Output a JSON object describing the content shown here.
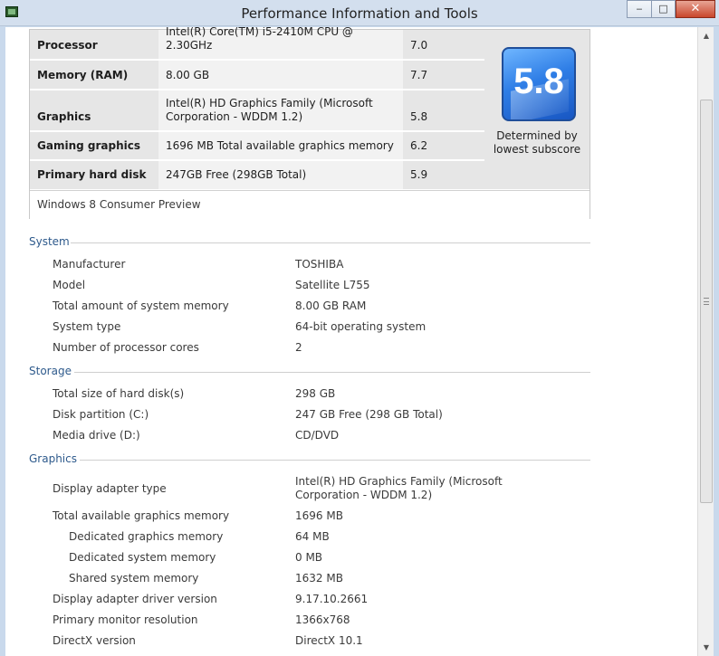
{
  "window": {
    "title": "Performance Information and Tools",
    "min_label": "▭",
    "max_label": "▢",
    "close_label": "✕"
  },
  "scores": {
    "rows": [
      {
        "component": "Processor",
        "rating": "Intel(R) Core(TM) i5-2410M CPU @ 2.30GHz",
        "subscore": "7.0"
      },
      {
        "component": "Memory (RAM)",
        "rating": "8.00 GB",
        "subscore": "7.7"
      },
      {
        "component": "Graphics",
        "rating": "Intel(R) HD Graphics Family (Microsoft Corporation - WDDM 1.2)",
        "subscore": "5.8"
      },
      {
        "component": "Gaming graphics",
        "rating": "1696 MB Total available graphics memory",
        "subscore": "6.2"
      },
      {
        "component": "Primary hard disk",
        "rating": "247GB Free (298GB Total)",
        "subscore": "5.9"
      }
    ],
    "base_score": "5.8",
    "base_caption": "Determined by lowest subscore",
    "edition": "Windows 8 Consumer Preview"
  },
  "system": {
    "heading": "System",
    "items": [
      {
        "label": "Manufacturer",
        "value": "TOSHIBA"
      },
      {
        "label": "Model",
        "value": "Satellite L755"
      },
      {
        "label": "Total amount of system memory",
        "value": "8.00 GB RAM"
      },
      {
        "label": "System type",
        "value": "64-bit operating system"
      },
      {
        "label": "Number of processor cores",
        "value": "2"
      }
    ]
  },
  "storage": {
    "heading": "Storage",
    "items": [
      {
        "label": "Total size of hard disk(s)",
        "value": "298 GB"
      },
      {
        "label": "Disk partition (C:)",
        "value": "247 GB Free (298 GB Total)"
      },
      {
        "label": "Media drive (D:)",
        "value": "CD/DVD"
      }
    ]
  },
  "graphics": {
    "heading": "Graphics",
    "items": [
      {
        "label": "Display adapter type",
        "value": "Intel(R) HD Graphics Family (Microsoft Corporation - WDDM 1.2)"
      },
      {
        "label": "Total available graphics memory",
        "value": "1696 MB"
      },
      {
        "label": "Dedicated graphics memory",
        "value": "64 MB"
      },
      {
        "label": "Dedicated system memory",
        "value": "0 MB"
      },
      {
        "label": "Shared system memory",
        "value": "1632 MB"
      },
      {
        "label": "Display adapter driver version",
        "value": "9.17.10.2661"
      },
      {
        "label": "Primary monitor resolution",
        "value": "1366x768"
      },
      {
        "label": "DirectX version",
        "value": "DirectX 10.1"
      }
    ]
  },
  "colors": {
    "section_heading": "#2e5a8c",
    "badge_blue": "#2f7ee6",
    "close_red": "#c9462c"
  },
  "icons": {
    "app": "performance-app-icon",
    "scroll_up": "chevron-up-icon",
    "scroll_down": "chevron-down-icon"
  }
}
